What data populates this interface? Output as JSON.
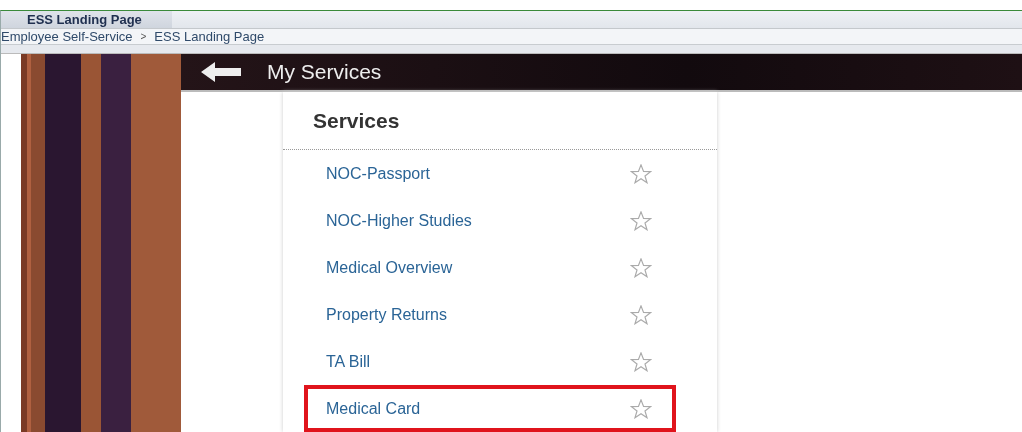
{
  "tab": {
    "label": "ESS Landing Page"
  },
  "breadcrumb": [
    {
      "label": "Employee Self-Service"
    },
    {
      "label": "ESS Landing Page"
    }
  ],
  "breadcrumb_separator": ">",
  "banner": {
    "title": "My Services"
  },
  "services": {
    "title": "Services",
    "items": [
      {
        "label": "NOC-Passport",
        "favorite": false,
        "highlighted": false
      },
      {
        "label": "NOC-Higher Studies",
        "favorite": false,
        "highlighted": false
      },
      {
        "label": "Medical Overview",
        "favorite": false,
        "highlighted": false
      },
      {
        "label": "Property Returns",
        "favorite": false,
        "highlighted": false
      },
      {
        "label": "TA Bill",
        "favorite": false,
        "highlighted": false
      },
      {
        "label": "Medical Card",
        "favorite": false,
        "highlighted": true
      }
    ]
  }
}
